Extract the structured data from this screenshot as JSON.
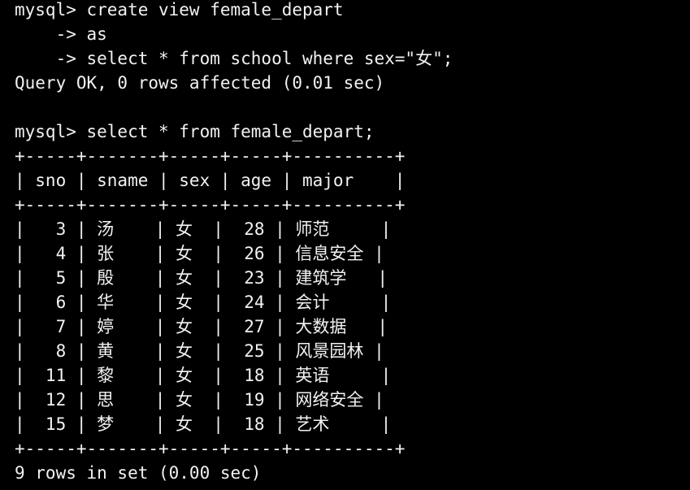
{
  "terminal": {
    "lines": [
      "mysql> create view female_depart",
      "    -> as",
      "    -> select * from school where sex=\"女\";",
      "Query OK, 0 rows affected (0.01 sec)",
      "",
      "mysql> select * from female_depart;",
      "+-----+-------+-----+-----+----------+",
      "| sno | sname | sex | age | major    |",
      "+-----+-------+-----+-----+----------+",
      "|   3 | 汤    | 女  |  28 | 师范     |",
      "|   4 | 张    | 女  |  26 | 信息安全 |",
      "|   5 | 殷    | 女  |  23 | 建筑学   |",
      "|   6 | 华    | 女  |  24 | 会计     |",
      "|   7 | 婷    | 女  |  27 | 大数据   |",
      "|   8 | 黄    | 女  |  25 | 风景园林 |",
      "|  11 | 黎    | 女  |  18 | 英语     |",
      "|  12 | 思    | 女  |  19 | 网络安全 |",
      "|  15 | 梦    | 女  |  18 | 艺术     |",
      "+-----+-------+-----+-----+----------+",
      "9 rows in set (0.00 sec)"
    ]
  }
}
